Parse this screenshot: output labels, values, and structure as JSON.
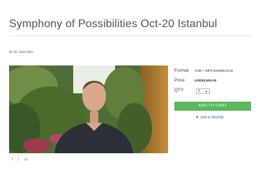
{
  "product": {
    "title": "Symphony of Possibilities Oct-20 Istanbul",
    "byline": "By Dr. Dain Heer"
  },
  "details": {
    "format_label": "Format",
    "format_value": "VOD + MP3 DOWNLOAD",
    "price_label": "Price",
    "price_value": "USD$3,500.00",
    "qty_label": "QTY",
    "qty_value": "1",
    "add_to_cart": "ADD TO CART",
    "wishlist": "Add to Wishlist"
  },
  "share": {
    "facebook": "f",
    "twitter": "t",
    "email": "✉"
  },
  "icons": [
    "facebook-icon",
    "twitter-icon",
    "email-icon",
    "heart-icon"
  ],
  "colors": {
    "cart_button": "#5cb85c",
    "wishlist_link": "#3d6ca8"
  }
}
